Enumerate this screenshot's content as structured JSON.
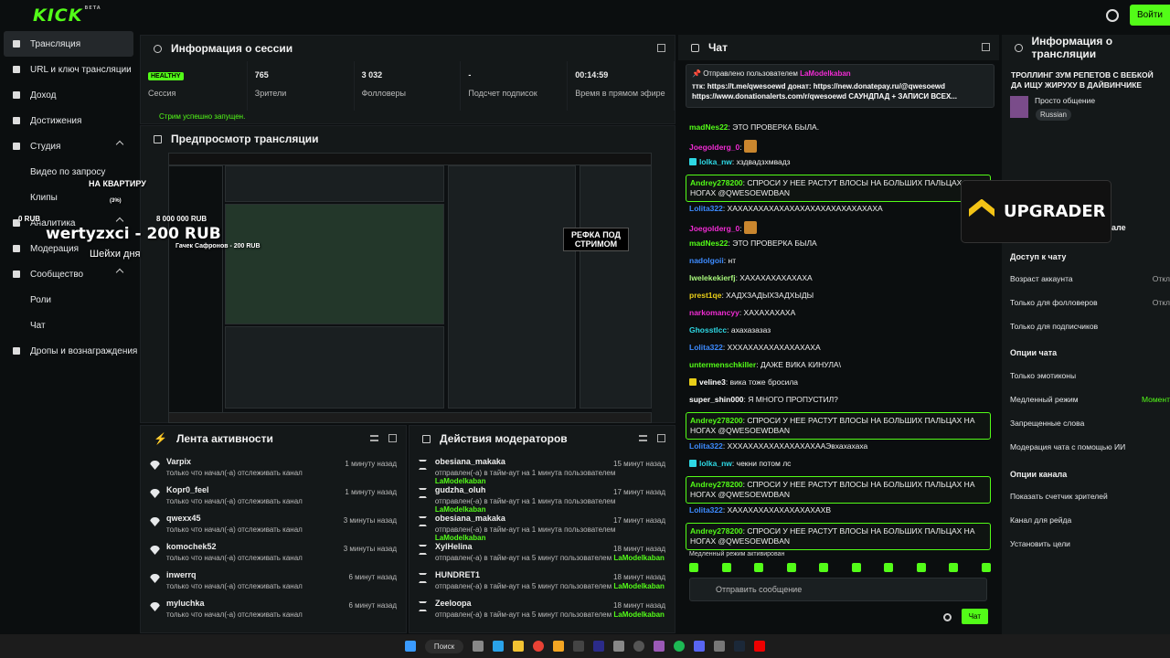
{
  "brand": {
    "logo": "KICK",
    "beta": "BETA"
  },
  "topbar": {
    "enter_label": "Войти"
  },
  "sidebar": {
    "items": [
      {
        "label": "Трансляция",
        "active": true,
        "sub": false
      },
      {
        "label": "URL и ключ трансляции",
        "sub": false
      },
      {
        "label": "Доход",
        "sub": false
      },
      {
        "label": "Достижения",
        "sub": false
      },
      {
        "label": "Студия",
        "sub": false,
        "chev": true
      },
      {
        "label": "Видео по запросу",
        "sub": true
      },
      {
        "label": "Клипы",
        "sub": true
      },
      {
        "label": "Аналитика",
        "sub": false,
        "chev": true
      },
      {
        "label": "Модерация",
        "sub": false
      },
      {
        "label": "Сообщество",
        "sub": false,
        "chev": true
      },
      {
        "label": "Роли",
        "sub": true
      },
      {
        "label": "Чат",
        "sub": true
      },
      {
        "label": "Дропы и вознаграждения",
        "sub": false
      }
    ]
  },
  "session": {
    "title": "Информация о сессии",
    "badge": "HEALTHY",
    "stats": [
      {
        "value": "",
        "label": "Сессия"
      },
      {
        "value": "765",
        "label": "Зрители"
      },
      {
        "value": "3 032",
        "label": "Фолловеры"
      },
      {
        "value": "-",
        "label": "Подсчет подписок"
      },
      {
        "value": "00:14:59",
        "label": "Время в прямом эфире"
      }
    ],
    "status": "Стрим успешно запущен."
  },
  "preview": {
    "title": "Предпросмотр трансляции",
    "refka": "РЕФКА ПОД СТРИМОМ"
  },
  "activity": {
    "title": "Лента активности",
    "rows": [
      {
        "name": "Varpix",
        "desc": "только что начал(-а) отслеживать канал",
        "time": "1 минуту назад"
      },
      {
        "name": "Kopr0_feel",
        "desc": "только что начал(-а) отслеживать канал",
        "time": "1 минуту назад"
      },
      {
        "name": "qwexx45",
        "desc": "только что начал(-а) отслеживать канал",
        "time": "3 минуты назад"
      },
      {
        "name": "komochek52",
        "desc": "только что начал(-а) отслеживать канал",
        "time": "3 минуты назад"
      },
      {
        "name": "inwerrq",
        "desc": "только что начал(-а) отслеживать канал",
        "time": "6 минут назад"
      },
      {
        "name": "myluchka",
        "desc": "только что начал(-а) отслеживать канал",
        "time": "6 минут назад"
      }
    ]
  },
  "moderators": {
    "title": "Действия модераторов",
    "rows": [
      {
        "name": "obesiana_makaka",
        "desc": "отправлен(-а) в тайм-аут на 1 минута пользователем",
        "mod": "LaModelkaban",
        "time": "15 минут назад"
      },
      {
        "name": "gudzha_oluh",
        "desc": "отправлен(-а) в тайм-аут на 1 минута пользователем",
        "mod": "LaModelkaban",
        "time": "17 минут назад"
      },
      {
        "name": "obesiana_makaka",
        "desc": "отправлен(-а) в тайм-аут на 1 минута пользователем",
        "mod": "LaModelkaban",
        "time": "17 минут назад"
      },
      {
        "name": "XylHelina",
        "desc": "отправлен(-а) в тайм-аут на 5 минут пользователем",
        "mod": "LaModelkaban",
        "time": "18 минут назад"
      },
      {
        "name": "HUNDRET1",
        "desc": "отправлен(-а) в тайм-аут на 5 минут пользователем",
        "mod": "LaModelkaban",
        "time": "18 минут назад"
      },
      {
        "name": "Zeeloopa",
        "desc": "отправлен(-а) в тайм-аут на 5 минут пользователем",
        "mod": "LaModelkaban",
        "time": "18 минут назад"
      }
    ]
  },
  "chat": {
    "title": "Чат",
    "pinned_by": "Отправлено пользователем",
    "pinned_user": "LaModelkaban",
    "pinned_text": "ттк: https://t.me/qwesoewd донат: https://new.donatepay.ru/@qwesoewd https://www.donationalerts.com/r/qwesoewd САУНДПАД + ЗАПИСИ ВСЕХ...",
    "messages": [
      {
        "user": "madNes22",
        "color": "green",
        "text": "ЭТО ПРОВЕРКА БЫЛА.",
        "hl": false
      },
      {
        "user": "Joegolderg_0",
        "color": "pink",
        "text": "",
        "hl": false,
        "emote": true
      },
      {
        "user": "lolka_nw",
        "color": "cyan",
        "text": "хздвадзхмвадз",
        "hl": false
      },
      {
        "user": "Andrey278200",
        "color": "green",
        "text": "СПРОСИ У НЕЕ РАСТУТ ВЛОСЫ НА БОЛЬШИХ ПАЛЬЦАХ НА НОГАХ @QWESOEWDBAN",
        "hl": true
      },
      {
        "user": "Lolita322",
        "color": "blue",
        "text": "ХАХАХАХАХАХАХАХАХАХАХАХАХАХАХА",
        "hl": false
      },
      {
        "user": "Joegolderg_0",
        "color": "pink",
        "text": "",
        "hl": false,
        "emote": true
      },
      {
        "user": "madNes22",
        "color": "green",
        "text": "ЭТО ПРОВЕРКА БЫЛА",
        "hl": false
      },
      {
        "user": "nadolgoii",
        "color": "blue",
        "text": "нт",
        "hl": false
      },
      {
        "user": "lwelekekierfj",
        "color": "lime",
        "text": "ХАХАХАХАХАХАХА",
        "hl": false
      },
      {
        "user": "prest1qe",
        "color": "yellow",
        "text": "ХАДХЗАДЫХЗАДХЫДЫ",
        "hl": false
      },
      {
        "user": "narkomancyy",
        "color": "pink",
        "text": "ХАХАХАХАХА",
        "hl": false
      },
      {
        "user": "Ghosstlcc",
        "color": "cyan",
        "text": "ахахазазаз",
        "hl": false
      },
      {
        "user": "Lolita322",
        "color": "blue",
        "text": "ХХХАХАХАХАХАХАХАХА",
        "hl": false
      },
      {
        "user": "untermenschkiller",
        "color": "green",
        "text": "ДАЖЕ ВИКА КИНУЛА\\",
        "hl": false
      },
      {
        "user": "veline3",
        "color": "white",
        "text": "вика тоже бросила",
        "hl": false
      },
      {
        "user": "super_shin000",
        "color": "white",
        "text": "Я МНОГО ПРОПУСТИЛ?",
        "hl": false
      },
      {
        "user": "Andrey278200",
        "color": "green",
        "text": "СПРОСИ У НЕЕ РАСТУТ ВЛОСЫ НА БОЛЬШИХ ПАЛЬЦАХ НА НОГАХ @QWESOEWDBAN",
        "hl": true
      },
      {
        "user": "Lolita322",
        "color": "blue",
        "text": "ХХХАХАХАХАХАХАХАХААЭвхахахаха",
        "hl": false
      },
      {
        "user": "lolka_nw",
        "color": "cyan",
        "text": "чекни потом лс",
        "hl": false
      },
      {
        "user": "Andrey278200",
        "color": "green",
        "text": "СПРОСИ У НЕЕ РАСТУТ ВЛОСЫ НА БОЛЬШИХ ПАЛЬЦАХ НА НОГАХ @QWESOEWDBAN",
        "hl": true
      },
      {
        "user": "Lolita322",
        "color": "blue",
        "text": "ХАХАХАХАХАХАХАХАХАХВ",
        "hl": false
      },
      {
        "user": "Andrey278200",
        "color": "green",
        "text": "СПРОСИ У НЕЕ РАСТУТ ВЛОСЫ НА БОЛЬШИХ ПАЛЬЦАХ НА НОГАХ @QWESOEWDBAN",
        "hl": true
      }
    ],
    "slow_mode": "Медленный режим активирован",
    "placeholder": "Отправить сообщение",
    "send": "Чат"
  },
  "stream_info": {
    "title": "Информация о трансляции",
    "stream_title": "ТРОЛЛИНГ ЗУМ РЕПЕТОВ С ВЕБКОЙ ДА ИЩУ ЖИРУХУ В ДАЙВИНЧИКЕ",
    "category": "Просто общение",
    "language": "Russian",
    "partial": "але",
    "access_title": "Доступ к чату",
    "access": [
      {
        "label": "Возраст аккаунта",
        "value": "Откл"
      },
      {
        "label": "Только для фолловеров",
        "value": "Откл"
      },
      {
        "label": "Только для подписчиков",
        "value": ""
      }
    ],
    "chat_opts_title": "Опции чата",
    "chat_opts": [
      {
        "label": "Только эмотиконы",
        "value": ""
      },
      {
        "label": "Медленный режим",
        "value": "Момент"
      },
      {
        "label": "Запрещенные слова",
        "value": ""
      },
      {
        "label": "Модерация чата с помощью ИИ",
        "value": ""
      }
    ],
    "channel_title": "Опции канала",
    "channel_opts": [
      {
        "label": "Показать счетчик зрителей"
      },
      {
        "label": "Канал для рейда"
      },
      {
        "label": "Установить цели"
      }
    ]
  },
  "overlays": {
    "apartment": "НА КВАРТИРУ",
    "pct": "(3%)",
    "rub0": "0 RUB",
    "donor": "wertyzxci - 200 RUB",
    "million": "8 000 000 RUB",
    "shake": "Шейхи дня",
    "safonov": "Гачек Сафронов - 200 RUB",
    "upgrader": "UPGRADER"
  },
  "taskbar": {
    "search": "Поиск"
  }
}
